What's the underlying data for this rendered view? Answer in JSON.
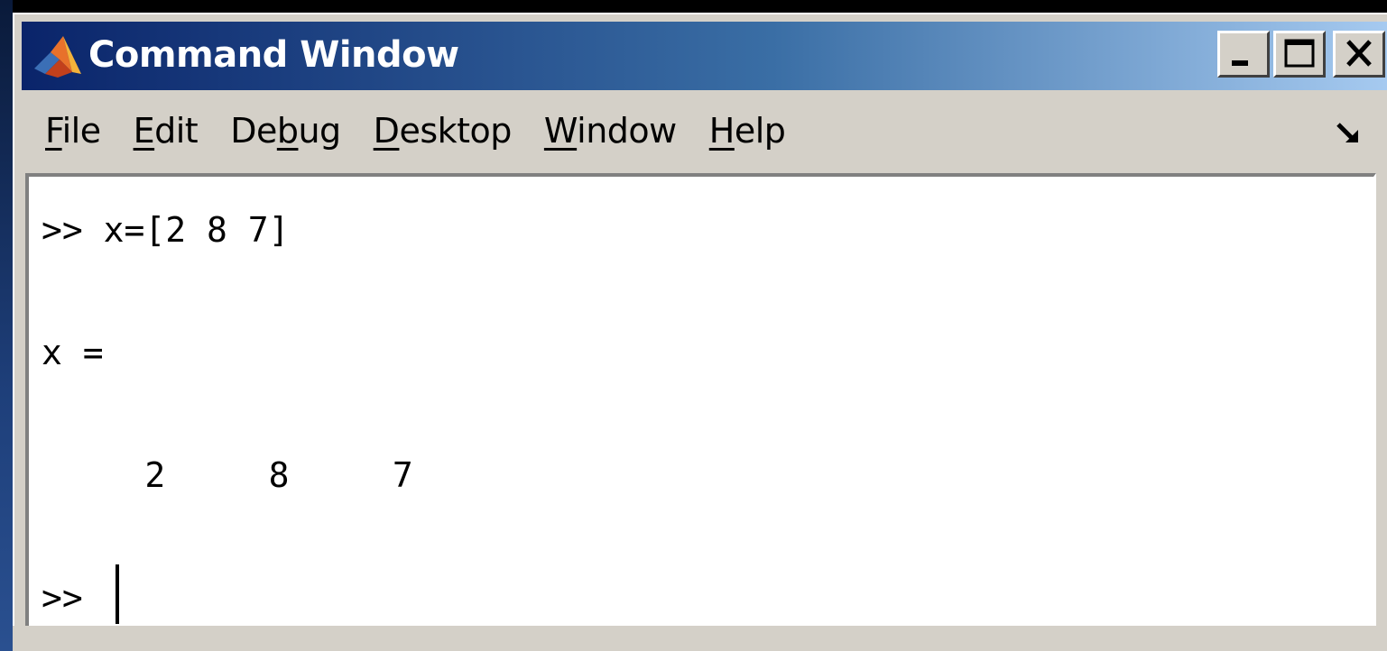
{
  "window": {
    "title": "Command Window",
    "icon": "matlab-logo-icon",
    "controls": {
      "minimize_icon": "minimize-icon",
      "maximize_icon": "maximize-icon",
      "close_icon": "close-icon"
    }
  },
  "menu": {
    "items": [
      {
        "label_ul": "F",
        "label_rest": "ile"
      },
      {
        "label_ul": "E",
        "label_rest": "dit"
      },
      {
        "label_pre": "De",
        "label_ul": "b",
        "label_rest": "ug"
      },
      {
        "label_ul": "D",
        "label_rest": "esktop"
      },
      {
        "label_ul": "W",
        "label_rest": "indow"
      },
      {
        "label_ul": "H",
        "label_rest": "elp"
      }
    ],
    "undock_icon": "undock-arrow-icon"
  },
  "console": {
    "lines": [
      ">> x=[2 8 7]",
      "x =",
      "     2     8     7",
      ">> "
    ]
  },
  "colors": {
    "titlebar_start": "#0a246a",
    "titlebar_end": "#a6caf0",
    "chrome": "#d4d0c8",
    "console_bg": "#ffffff"
  }
}
